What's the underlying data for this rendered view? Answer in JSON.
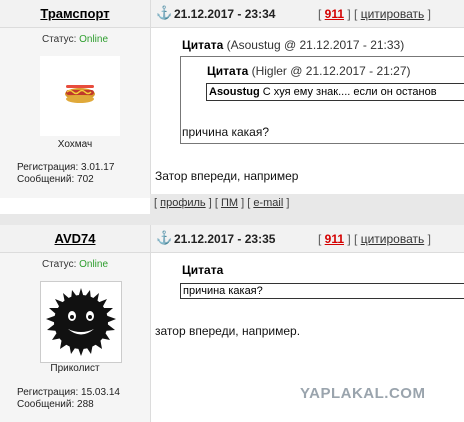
{
  "posts": [
    {
      "username": "Трамспорт",
      "date": "21.12.2017 - 23:34",
      "rating": "911",
      "quote_action": "цитировать",
      "status_label": "Статус:",
      "status_value": "Online",
      "rank": "Хохмач",
      "reg_label": "Регистрация:",
      "reg_value": "3.01.17",
      "msgs_label": "Сообщений:",
      "msgs_value": "702",
      "quote_outer_label": "Цитата",
      "quote_outer_meta": "(Asoustug @ 21.12.2017 - 21:33)",
      "quote_inner_label": "Цитата",
      "quote_inner_meta": "(Higler @ 21.12.2017 - 21:27)",
      "quote_inner_author": "Asoustug",
      "quote_inner_text": "С хуя ему знак.... если он останов",
      "quote_outer_text": "причина какая?",
      "message": "Затор впереди, например",
      "link_profile": "профиль",
      "link_pm": "ПМ",
      "link_email": "e-mail"
    },
    {
      "username": "AVD74",
      "date": "21.12.2017 - 23:35",
      "rating": "911",
      "quote_action": "цитировать",
      "status_label": "Статус:",
      "status_value": "Online",
      "rank": "Приколист",
      "reg_label": "Регистрация:",
      "reg_value": "15.03.14",
      "msgs_label": "Сообщений:",
      "msgs_value": "288",
      "quote_label": "Цитата",
      "quote_text": "причина какая?",
      "message": "затор впереди, например."
    }
  ],
  "watermark": "YAPLAKAL.COM",
  "colors": {
    "online": "#2e9e2e",
    "rating": "#d40000",
    "anchor": "#1d6fa5"
  },
  "icons": {
    "post_anchor": "anchor-icon"
  }
}
